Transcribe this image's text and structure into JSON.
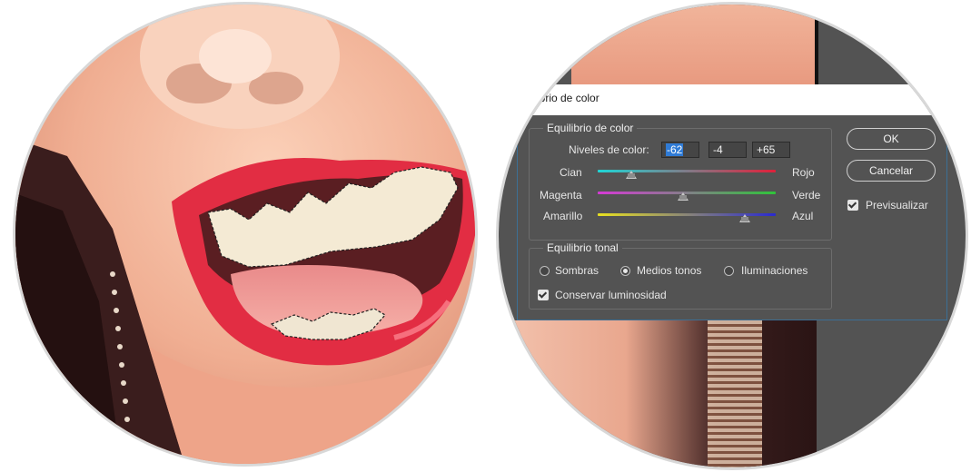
{
  "dialog": {
    "title": "ibrio de color",
    "color_balance": {
      "group_title": "Equilibrio de color",
      "levels_label": "Niveles de color:",
      "levels": [
        "-62",
        "-4",
        "+65"
      ],
      "sliders": [
        {
          "left": "Cian",
          "right": "Rojo",
          "value": -62,
          "colors": [
            "#1fd6d6",
            "#e0203a"
          ]
        },
        {
          "left": "Magenta",
          "right": "Verde",
          "value": -4,
          "colors": [
            "#d63ad6",
            "#2fc43a"
          ]
        },
        {
          "left": "Amarillo",
          "right": "Azul",
          "value": 65,
          "colors": [
            "#e8e020",
            "#2a2ad0"
          ]
        }
      ],
      "range": [
        -100,
        100
      ]
    },
    "tonal_balance": {
      "group_title": "Equilibrio tonal",
      "options": [
        "Sombras",
        "Medios tonos",
        "Iluminaciones"
      ],
      "selected": "Medios tonos",
      "preserve_luminosity_label": "Conservar luminosidad",
      "preserve_luminosity": true
    },
    "buttons": {
      "ok": "OK",
      "cancel": "Cancelar"
    },
    "preview": {
      "label": "Previsualizar",
      "checked": true
    }
  }
}
